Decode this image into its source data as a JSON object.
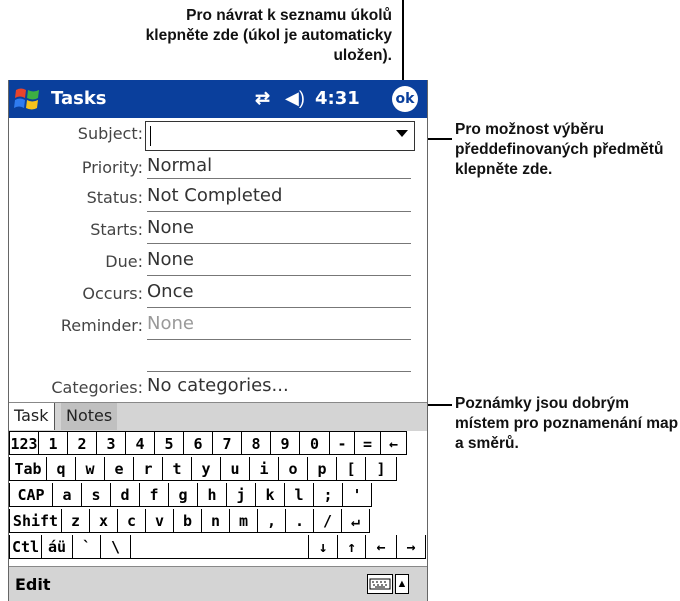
{
  "callouts": {
    "top": "Pro návrat k seznamu úkolů klepněte zde (úkol je automaticky uložen).",
    "right": "Pro možnost výběru předdefinovaných předmětů klepněte zde.",
    "notes": "Poznámky jsou dobrým místem pro poznamenání map a směrů."
  },
  "titlebar": {
    "title": "Tasks",
    "time": "4:31",
    "ok_label": "ok"
  },
  "form": {
    "subject_label": "Subject:",
    "subject_value": "",
    "priority_label": "Priority:",
    "priority_value": "Normal",
    "status_label": "Status:",
    "status_value": "Not Completed",
    "starts_label": "Starts:",
    "starts_value": "None",
    "due_label": "Due:",
    "due_value": "None",
    "occurs_label": "Occurs:",
    "occurs_value": "Once",
    "reminder_label": "Reminder:",
    "reminder_value": "None",
    "categories_label": "Categories:",
    "categories_value": "No categories..."
  },
  "tabs": {
    "task": "Task",
    "notes": "Notes"
  },
  "keyboard": {
    "row1": [
      "123",
      "1",
      "2",
      "3",
      "4",
      "5",
      "6",
      "7",
      "8",
      "9",
      "0",
      "-",
      "=",
      "←"
    ],
    "row2": [
      "Tab",
      "q",
      "w",
      "e",
      "r",
      "t",
      "y",
      "u",
      "i",
      "o",
      "p",
      "[",
      "]"
    ],
    "row3": [
      "CAP",
      "a",
      "s",
      "d",
      "f",
      "g",
      "h",
      "j",
      "k",
      "l",
      ";",
      "'"
    ],
    "row4": [
      "Shift",
      "z",
      "x",
      "c",
      "v",
      "b",
      "n",
      "m",
      ",",
      ".",
      "/",
      "↵"
    ],
    "row5": [
      "Ctl",
      "áü",
      "`",
      "\\",
      "",
      "↓",
      "↑",
      "←",
      "→"
    ]
  },
  "menubar": {
    "edit": "Edit"
  },
  "colors": {
    "titlebar": "#0a3f9c",
    "bar": "#d4d4d4"
  }
}
